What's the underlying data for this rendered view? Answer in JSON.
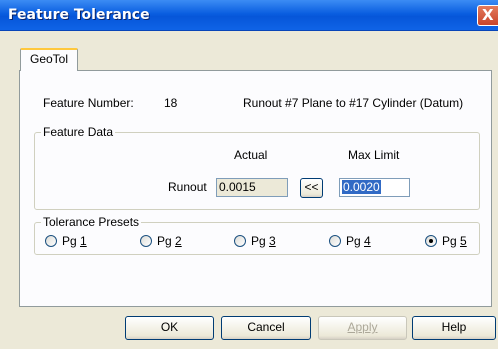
{
  "window": {
    "title": "Feature Tolerance",
    "close_glyph": "X"
  },
  "tabs": [
    {
      "label": "GeoTol",
      "active": true
    }
  ],
  "feature": {
    "number_label": "Feature Number:",
    "number_value": "18",
    "description": "Runout #7 Plane to #17 Cylinder (Datum)"
  },
  "feature_data": {
    "legend": "Feature Data",
    "actual_header": "Actual",
    "max_header": "Max Limit",
    "row_label": "Runout",
    "actual_value": "0.0015",
    "copy_button": "<<",
    "max_value": "0.0020"
  },
  "presets": {
    "legend": "Tolerance Presets",
    "options": [
      {
        "prefix": "Pg ",
        "key": "1",
        "checked": false
      },
      {
        "prefix": "Pg ",
        "key": "2",
        "checked": false
      },
      {
        "prefix": "Pg ",
        "key": "3",
        "checked": false
      },
      {
        "prefix": "Pg ",
        "key": "4",
        "checked": false
      },
      {
        "prefix": "Pg ",
        "key": "5",
        "checked": true
      }
    ]
  },
  "buttons": {
    "ok": "OK",
    "cancel": "Cancel",
    "apply": "Apply",
    "help": "Help"
  },
  "colors": {
    "titlebar": "#0a5ee0",
    "dialog_bg": "#ece9d8",
    "selection": "#316ac5"
  }
}
